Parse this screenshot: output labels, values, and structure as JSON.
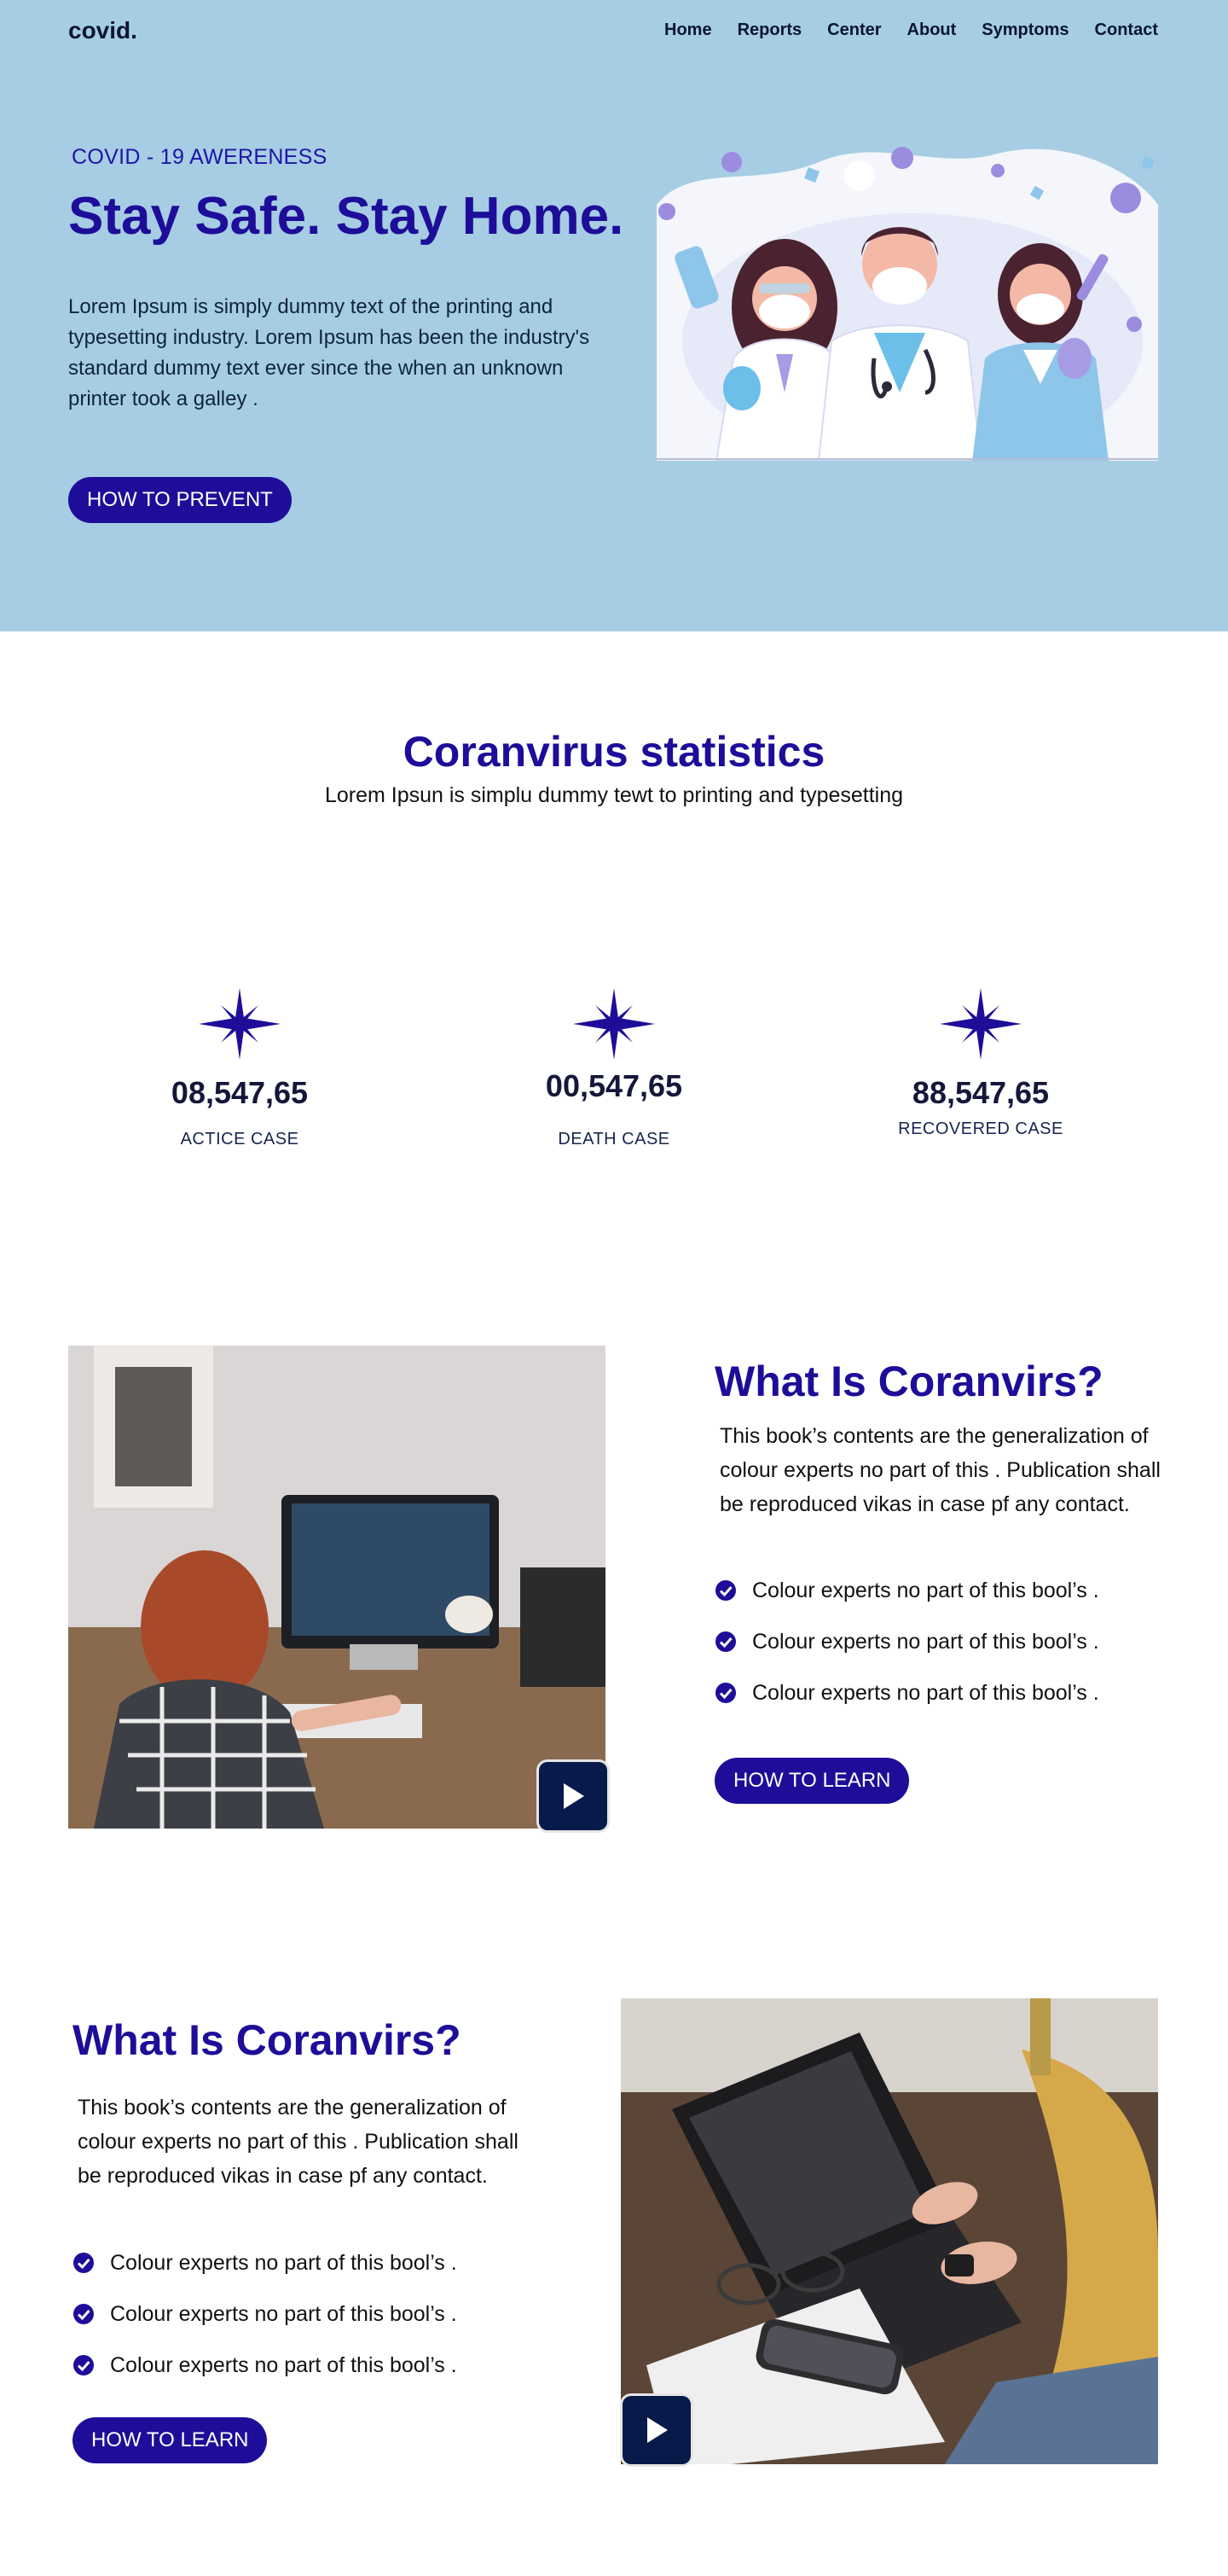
{
  "brand": {
    "logo": "covid."
  },
  "nav": {
    "items": [
      "Home",
      "Reports",
      "Center",
      "About",
      "Symptoms",
      "Contact"
    ]
  },
  "hero": {
    "eyebrow": "COVID - 19 AWERENESS",
    "title": "Stay Safe. Stay Home.",
    "text": "Lorem Ipsum is simply dummy text of the printing and typesetting industry. Lorem Ipsum has been the industry's standard dummy text ever since the when an unknown printer took a galley .",
    "button": "HOW TO PREVENT"
  },
  "stats": {
    "title": "Coranvirus statistics",
    "subtitle": "Lorem Ipsun is simplu dummy tewt to printing and typesetting",
    "items": [
      {
        "value": "08,547,65",
        "label": "ACTICE CASE"
      },
      {
        "value": "00,547,65",
        "label": "DEATH CASE"
      },
      {
        "value": "88,547,65",
        "label": "RECOVERED CASE"
      }
    ]
  },
  "section1": {
    "title": "What Is Coranvirs?",
    "text": "This book’s contents are the generalization of colour experts no part of this . Publication shall be reproduced  vikas in case pf any contact.",
    "checks": [
      "Colour experts no part of this  bool’s .",
      "Colour experts no part of this  bool’s .",
      "Colour experts no part of this  bool’s ."
    ],
    "button": "HOW TO LEARN"
  },
  "section2": {
    "title": "What Is Coranvirs?",
    "text": "This book’s contents are the generalization of colour experts no part of this . Publication shall be reproduced  vikas in case pf any contact.",
    "checks": [
      "Colour experts no part of this  bool’s .",
      "Colour experts no part of this  bool’s .",
      "Colour experts no part of this  bool’s ."
    ],
    "button": "HOW TO LEARN"
  },
  "icons": {
    "stat": "star-icon",
    "check": "check-circle-icon",
    "play": "play-icon"
  },
  "colors": {
    "hero_bg": "#a6cde3",
    "primary": "#1e0d99",
    "play_bg": "#081a4a"
  }
}
